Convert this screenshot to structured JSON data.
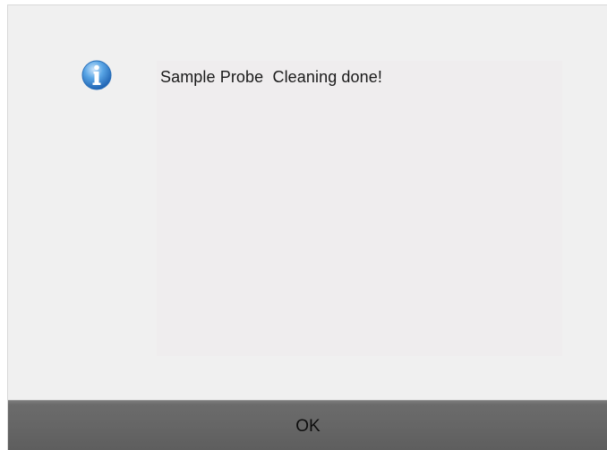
{
  "dialog": {
    "icon": "info-icon",
    "message": "Sample Probe  Cleaning done!",
    "ok_label": "OK"
  },
  "colors": {
    "dialog_bg": "#f0f0f0",
    "panel_bg": "#efedee",
    "button_bg": "#666666",
    "icon_blue": "#2b7fd1"
  }
}
